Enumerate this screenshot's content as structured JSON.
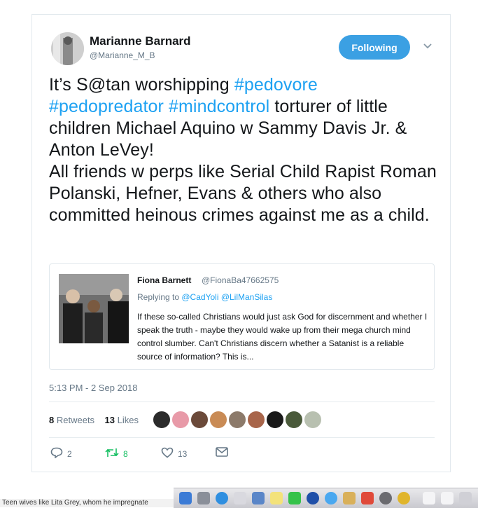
{
  "tweet": {
    "display_name": "Marianne Barnard",
    "handle": "@Marianne_M_B",
    "follow_label": "Following",
    "text_1": "It’s S@tan worshipping ",
    "hashtag_1": "#pedovore",
    "hashtag_2": "#pedopredator",
    "hashtag_3": "#mindcontrol",
    "text_2": " torturer of little children Michael Aquino w Sammy Davis Jr. & Anton LeVey!",
    "text_3": "All friends w perps like Serial Child Rapist Roman Polanski, Hefner, Evans & others who also committed heinous crimes against me as a child.",
    "timestamp": "5:13 PM - 2 Sep 2018",
    "retweets_count": "8",
    "retweets_label": "Retweets",
    "likes_count": "13",
    "likes_label": "Likes"
  },
  "quote": {
    "name": "Fiona Barnett",
    "handle": "@FionaBa47662575",
    "replying_prefix": "Replying to ",
    "mentions": "@CadYoli @LilManSilas",
    "text": "If these so-called Christians would just ask God for discernment and whether I speak the truth - maybe they would wake up from their mega church mind control slumber. Can't Christians discern whether a Satanist is a reliable source of information? This is..."
  },
  "actions": {
    "reply_count": "2",
    "retweet_count": "8",
    "like_count": "13"
  },
  "colors": {
    "accent": "#1da1f2",
    "follow_button": "#3ba0e3",
    "retweet_green": "#17bf63"
  },
  "status_bar": {
    "text": "Teen wives like Lita Grey, whom he impregnate"
  }
}
